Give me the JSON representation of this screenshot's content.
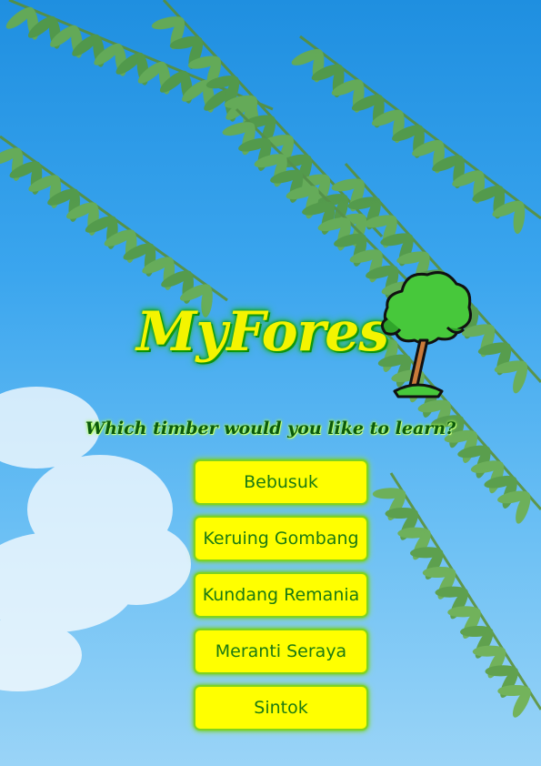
{
  "app": {
    "logo_text": "MyFores",
    "prompt": "Which timber would you like to learn?"
  },
  "timbers": [
    {
      "label": "Bebusuk"
    },
    {
      "label": "Keruing Gombang"
    },
    {
      "label": "Kundang Remania"
    },
    {
      "label": "Meranti Seraya"
    },
    {
      "label": "Sintok"
    }
  ],
  "colors": {
    "sky": "#3aa5ee",
    "leaf": "#5f9e34",
    "button_bg": "#ffff00",
    "button_text": "#1c7a12",
    "button_border": "#7ed321",
    "logo_text": "#f4f400",
    "prompt_text": "#0b5a0b"
  },
  "icons": {
    "logo": "tree-icon"
  }
}
